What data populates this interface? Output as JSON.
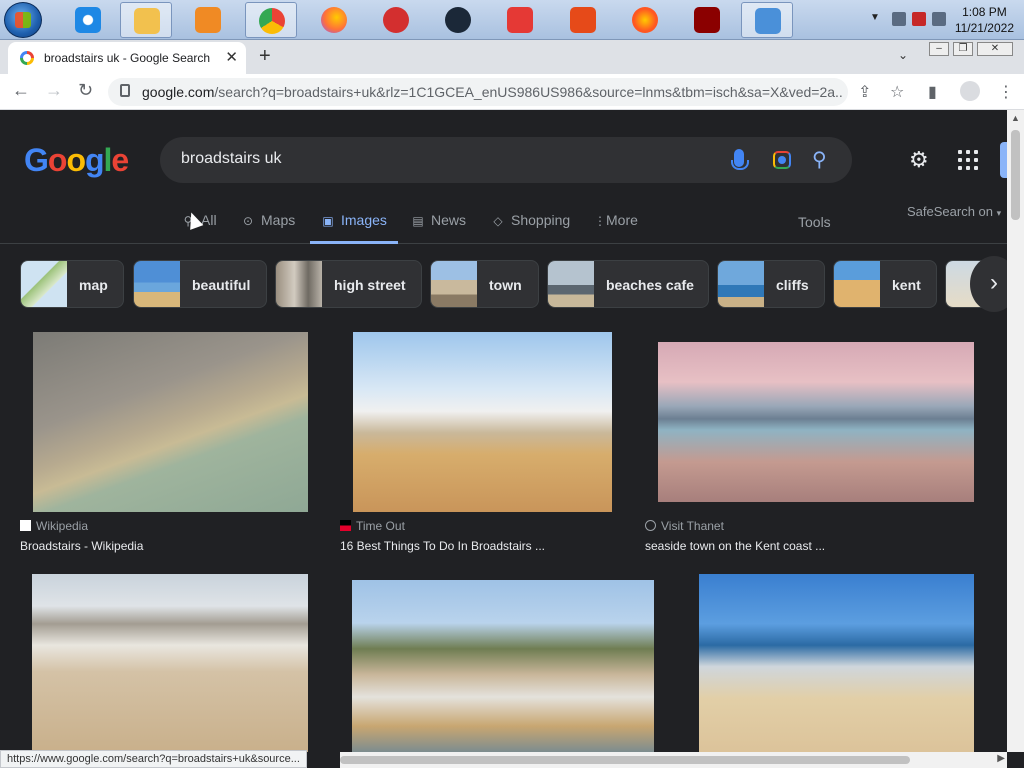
{
  "taskbar": {
    "apps": [
      {
        "name": "internet-explorer",
        "color": "#1e88e5"
      },
      {
        "name": "file-explorer",
        "color": "#f2c14e"
      },
      {
        "name": "media-player",
        "color": "#f08a24"
      },
      {
        "name": "chrome",
        "color": "#34a853"
      },
      {
        "name": "firefox",
        "color": "#ff7139"
      },
      {
        "name": "ccleaner",
        "color": "#d32f2f"
      },
      {
        "name": "steam",
        "color": "#1b2838"
      },
      {
        "name": "acrobat",
        "color": "#e53935"
      },
      {
        "name": "app-red",
        "color": "#e64a19"
      },
      {
        "name": "firefox-dev",
        "color": "#ff5722"
      },
      {
        "name": "flash",
        "color": "#8b0000"
      },
      {
        "name": "control-panel",
        "color": "#4a90d9"
      }
    ],
    "clock_time": "1:08 PM",
    "clock_date": "11/21/2022"
  },
  "browser": {
    "tab_title": "broadstairs uk - Google Search",
    "new_tab": "+",
    "url_domain": "google.com",
    "url_rest": "/search?q=broadstairs+uk&rlz=1C1GCEA_enUS986US986&source=lnms&tbm=isch&sa=X&ved=2a...",
    "status_url": "https://www.google.com/search?q=broadstairs+uk&source..."
  },
  "page": {
    "search_query": "broadstairs uk",
    "tabs": [
      {
        "label": "All",
        "icon": "search-icon"
      },
      {
        "label": "Maps",
        "icon": "pin-icon"
      },
      {
        "label": "Images",
        "icon": "image-icon"
      },
      {
        "label": "News",
        "icon": "news-icon"
      },
      {
        "label": "Shopping",
        "icon": "tag-icon"
      },
      {
        "label": "More",
        "icon": "more-icon"
      }
    ],
    "tools": "Tools",
    "safesearch": "SafeSearch on",
    "chips": [
      "map",
      "beautiful",
      "high street",
      "town",
      "beaches cafe",
      "cliffs",
      "kent"
    ],
    "results": [
      {
        "source": "Wikipedia",
        "caption": "Broadstairs - Wikipedia"
      },
      {
        "source": "Time Out",
        "caption": "16 Best Things To Do In Broadstairs ..."
      },
      {
        "source": "Visit Thanet",
        "caption": "seaside town on the Kent coast ..."
      }
    ]
  },
  "colors": {
    "bg": "#202124",
    "accent": "#8ab4f8",
    "text": "#e8eaed",
    "muted": "#9aa0a6"
  }
}
